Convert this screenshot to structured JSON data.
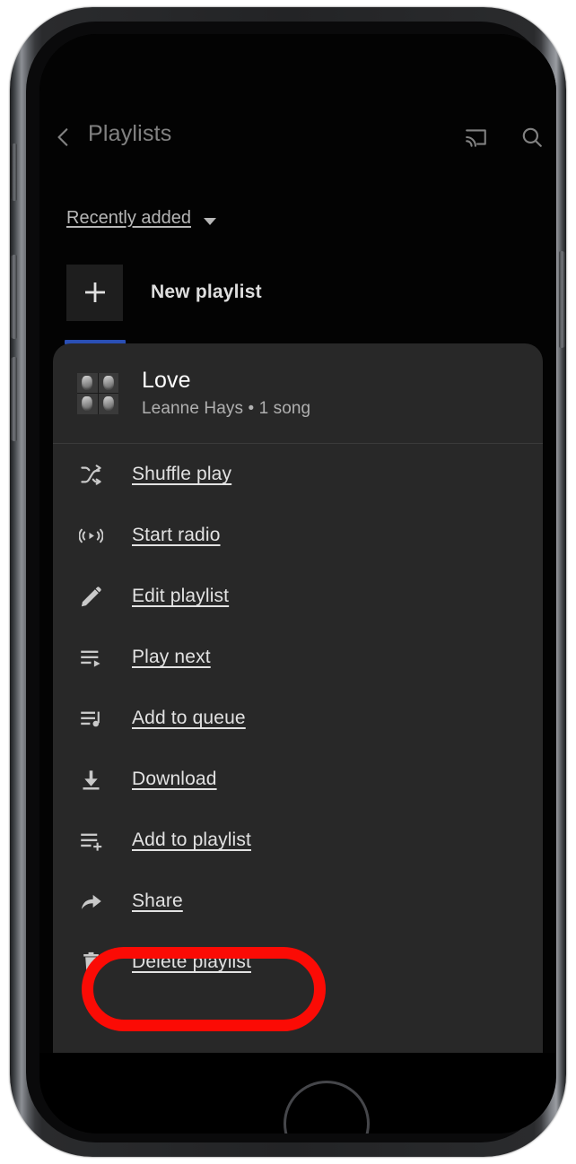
{
  "device": {
    "name": "iphone-frame",
    "front_camera": "front-camera",
    "earpiece": "earpiece-speaker",
    "home_button": "home-button",
    "buttons": [
      "mute-switch",
      "volume-up-button",
      "volume-down-button",
      "power-button"
    ]
  },
  "app": {
    "top_bar": {
      "back_label": "back",
      "title": "Playlists",
      "cast_label": "cast",
      "search_label": "search"
    },
    "sort": {
      "label": "Recently added",
      "chevron": "chevron-down-icon"
    },
    "new_playlist": {
      "icon": "plus-icon",
      "label": "New playlist"
    }
  },
  "sheet": {
    "playlist": {
      "name": "Love",
      "subtitle": "Leanne Hays • 1 song",
      "owner": "Leanne Hays",
      "song_count": "1 song",
      "thumbnail": "playlist-grid-thumbnail"
    },
    "menu_items": [
      {
        "icon": "shuffle-icon",
        "label": "Shuffle play"
      },
      {
        "icon": "radio-icon",
        "label": "Start radio"
      },
      {
        "icon": "pencil-icon",
        "label": "Edit playlist"
      },
      {
        "icon": "play-next-icon",
        "label": "Play next"
      },
      {
        "icon": "add-to-queue-icon",
        "label": "Add to queue"
      },
      {
        "icon": "download-icon",
        "label": "Download"
      },
      {
        "icon": "add-to-playlist-icon",
        "label": "Add to playlist"
      },
      {
        "icon": "share-icon",
        "label": "Share"
      },
      {
        "icon": "trash-icon",
        "label": "Delete playlist"
      }
    ]
  },
  "annotation": {
    "shape": "oval",
    "target": "Delete playlist",
    "color": "#fb0b05"
  },
  "colors": {
    "screen_background": "#030303",
    "sheet_background": "#282828",
    "accent_tab_indicator": "#2a4fb5",
    "primary_text": "#ffffff",
    "secondary_text": "#b0b0b0",
    "menu_text": "#e2e2e2",
    "annotation_red": "#fb0b05"
  }
}
